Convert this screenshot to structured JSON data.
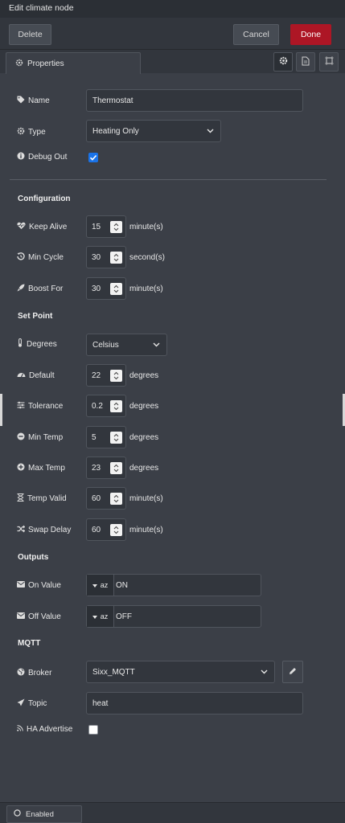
{
  "window": {
    "title": "Edit climate node"
  },
  "toolbar": {
    "delete_label": "Delete",
    "cancel_label": "Cancel",
    "done_label": "Done"
  },
  "tabs": {
    "properties_label": "Properties"
  },
  "fields": {
    "name": {
      "label": "Name",
      "value": "Thermostat"
    },
    "type": {
      "label": "Type",
      "value": "Heating Only"
    },
    "debug": {
      "label": "Debug Out",
      "checked": true
    }
  },
  "configuration": {
    "heading": "Configuration",
    "keep_alive": {
      "label": "Keep Alive",
      "value": "15",
      "unit": "minute(s)"
    },
    "min_cycle": {
      "label": "Min Cycle",
      "value": "30",
      "unit": "second(s)"
    },
    "boost_for": {
      "label": "Boost For",
      "value": "30",
      "unit": "minute(s)"
    }
  },
  "set_point": {
    "heading": "Set Point",
    "degrees": {
      "label": "Degrees",
      "value": "Celsius"
    },
    "default": {
      "label": "Default",
      "value": "22",
      "unit": "degrees"
    },
    "tolerance": {
      "label": "Tolerance",
      "value": "0.2",
      "unit": "degrees"
    },
    "min_temp": {
      "label": "Min Temp",
      "value": "5",
      "unit": "degrees"
    },
    "max_temp": {
      "label": "Max Temp",
      "value": "23",
      "unit": "degrees"
    },
    "temp_valid": {
      "label": "Temp Valid",
      "value": "60",
      "unit": "minute(s)"
    },
    "swap_delay": {
      "label": "Swap Delay",
      "value": "60",
      "unit": "minute(s)"
    }
  },
  "outputs": {
    "heading": "Outputs",
    "on_value": {
      "label": "On Value",
      "type_glyph": "az",
      "value": "ON"
    },
    "off_value": {
      "label": "Off Value",
      "type_glyph": "az",
      "value": "OFF"
    }
  },
  "mqtt": {
    "heading": "MQTT",
    "broker": {
      "label": "Broker",
      "value": "Sixx_MQTT"
    },
    "topic": {
      "label": "Topic",
      "value": "heat"
    },
    "ha_advertise": {
      "label": "HA Advertise",
      "checked": false
    }
  },
  "footer": {
    "enabled_label": "Enabled"
  },
  "colors": {
    "accent_red": "#ad1625",
    "checkbox_blue": "#1a73e8",
    "background": "#3b3f47"
  },
  "icons": [
    "gear-icon",
    "file-icon",
    "frame-icon",
    "tag-icon",
    "info-icon",
    "heartbeat-icon",
    "history-icon",
    "rocket-icon",
    "thermometer-icon",
    "dashboard-icon",
    "sliders-icon",
    "minus-circle-icon",
    "plus-circle-icon",
    "hourglass-icon",
    "shuffle-icon",
    "envelope-icon",
    "globe-icon",
    "send-icon",
    "rss-icon",
    "pencil-icon",
    "chevron-down-icon",
    "caret-down-icon"
  ]
}
